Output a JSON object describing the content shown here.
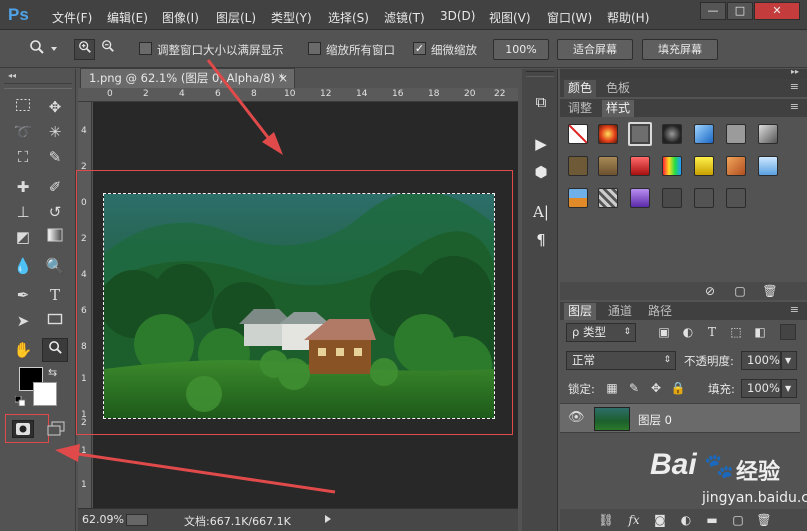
{
  "app": {
    "logo_text": "Ps",
    "menu": [
      "文件(F)",
      "编辑(E)",
      "图像(I)",
      "图层(L)",
      "类型(Y)",
      "选择(S)",
      "滤镜(T)",
      "3D(D)",
      "视图(V)",
      "窗口(W)",
      "帮助(H)"
    ],
    "window_buttons": {
      "minimize": "—",
      "restore": "□",
      "close": "✕"
    }
  },
  "options_bar": {
    "resize_windows_label": "调整窗口大小以满屏显示",
    "zoom_all_label": "缩放所有窗口",
    "scrubby_zoom_label": "细微缩放",
    "scrubby_zoom_checked": true,
    "zoom_value": "100%",
    "fit_screen": "适合屏幕",
    "fill_screen": "填充屏幕"
  },
  "document": {
    "tab_title": "1.png @ 62.1% (图层 0, Alpha/8) *",
    "tab_close": "×",
    "ruler_h": [
      "0",
      "2",
      "4",
      "6",
      "8",
      "10",
      "12",
      "14",
      "16",
      "18",
      "20",
      "22"
    ],
    "ruler_v_top": [
      "4",
      "2"
    ],
    "ruler_v": [
      "0",
      "2",
      "4",
      "6",
      "8",
      "1",
      "1",
      "1",
      "1",
      "2"
    ],
    "zoom_status": "62.09%",
    "doc_info": "文档:667.1K/667.1K"
  },
  "panels": {
    "color_tabs": [
      "颜色",
      "色板"
    ],
    "style_tabs": [
      "调整",
      "样式"
    ],
    "active_style_tab": "样式",
    "layers_tabs": [
      "图层",
      "通道",
      "路径"
    ],
    "kind_filter": "ρ 类型",
    "blend_mode": "正常",
    "opacity_label": "不透明度:",
    "opacity_value": "100%",
    "lock_label": "锁定:",
    "fill_label": "填充:",
    "fill_value": "100%",
    "layer_name": "图层 0"
  },
  "watermark": {
    "brand": "Bai",
    "brand_suffix": "经验",
    "url": "jingyan.baidu.com"
  },
  "colors": {
    "menubar": "#424242",
    "panel": "#535353",
    "canvas_bg": "#282828",
    "annotation_red": "#e04a4a",
    "accent_blue": "#4fa3e6"
  }
}
